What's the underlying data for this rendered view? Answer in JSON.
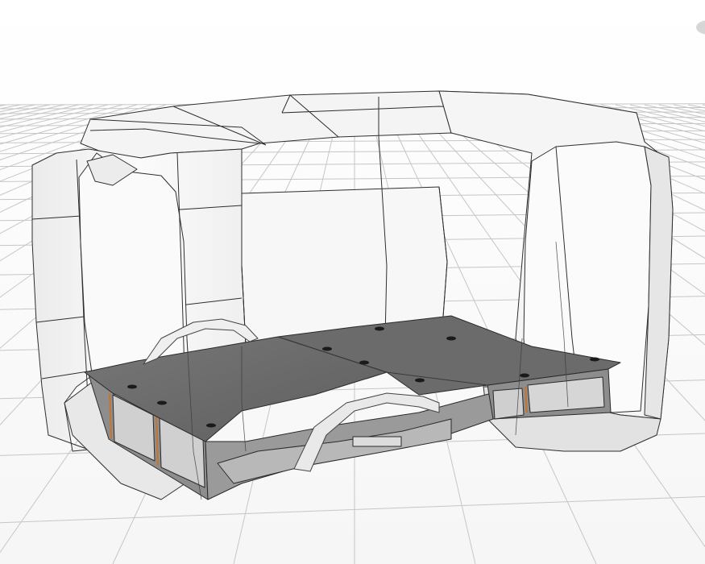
{
  "viewport": {
    "background": "#ffffff",
    "grid_line_color": "#c6c6c6",
    "horizon_color": "#f7f7f7"
  },
  "model": {
    "body_shell_color": "#f2f2f2",
    "edge_color": "#2e2e2e",
    "floor_panel_color": "#6e6e6e",
    "floor_panel_dark": "#5a5a5a",
    "drawer_frame_color": "#8d8d8d",
    "drawer_front_color": "#d5d5d5",
    "accent_hinge_color": "#c8742a"
  },
  "overlay": {
    "view_cube_icon": "navigation-orb-icon"
  }
}
